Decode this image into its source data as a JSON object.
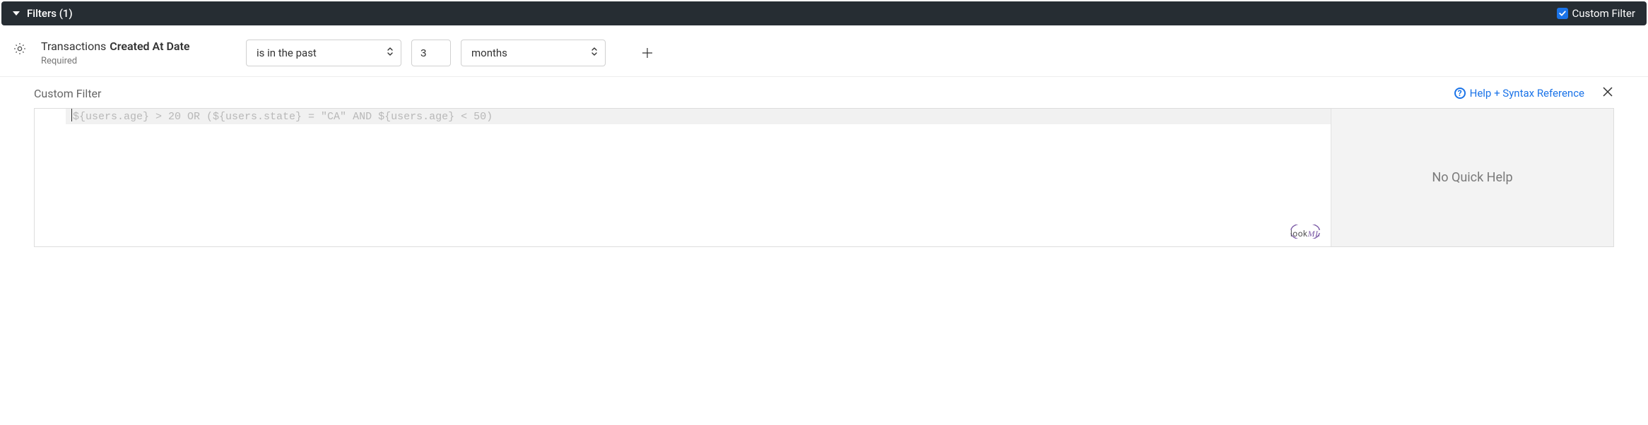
{
  "header": {
    "title": "Filters (1)",
    "custom_filter_checkbox_label": "Custom Filter",
    "custom_filter_checked": true
  },
  "filter_row": {
    "source_label": "Transactions",
    "field_label": "Created At Date",
    "required_text": "Required",
    "operator": "is in the past",
    "quantity": "3",
    "unit": "months"
  },
  "custom_filter": {
    "section_title": "Custom Filter",
    "help_link_text": "Help + Syntax Reference",
    "placeholder_expression": "${users.age} > 20 OR (${users.state} = \"CA\" AND ${users.age} < 50)",
    "quick_help_text": "No Quick Help",
    "badge_prefix": "look",
    "badge_suffix": "ML"
  }
}
